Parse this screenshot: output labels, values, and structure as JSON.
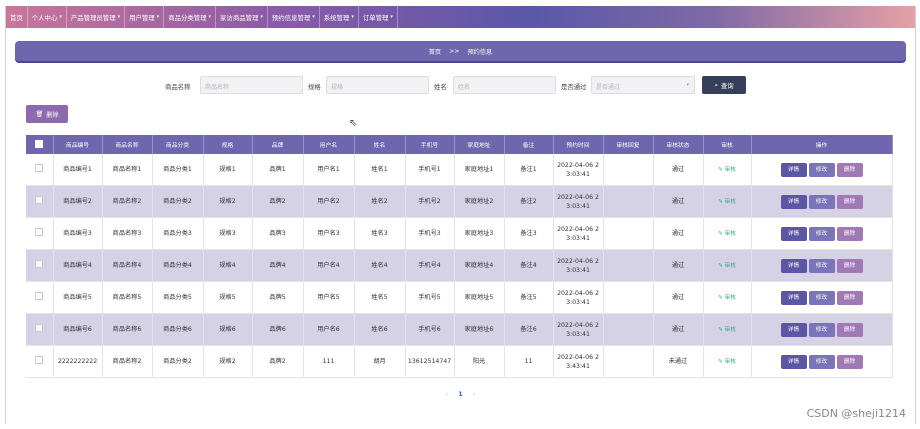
{
  "nav": [
    {
      "label": "首页",
      "arrow": ""
    },
    {
      "label": "个人中心",
      "arrow": "▾"
    },
    {
      "label": "产品管理员管理",
      "arrow": "▾"
    },
    {
      "label": "用户管理",
      "arrow": "▾"
    },
    {
      "label": "商品分类管理",
      "arrow": "▾"
    },
    {
      "label": "家访商品管理",
      "arrow": "▾"
    },
    {
      "label": "预约信息管理",
      "arrow": "▾"
    },
    {
      "label": "系统管理",
      "arrow": "▾"
    },
    {
      "label": "订单管理",
      "arrow": "▾"
    }
  ],
  "breadcrumb": {
    "home": "首页",
    "sep": ">>",
    "current": "预约信息"
  },
  "search": {
    "name_label": "商品名称",
    "name_placeholder": "商品名称",
    "spec_label": "规格",
    "spec_placeholder": "规格",
    "person_label": "姓名",
    "person_placeholder": "姓名",
    "pass_label": "是否通过",
    "pass_placeholder": "是否通过",
    "button_label": "查询"
  },
  "delete_button": "删除",
  "columns": [
    "商品编号",
    "商品名称",
    "商品分类",
    "规格",
    "品牌",
    "用户名",
    "姓名",
    "手机号",
    "家庭地址",
    "备注",
    "预约时间",
    "审核回复",
    "审核状态",
    "审核",
    "操作"
  ],
  "rows": [
    {
      "code": "商品编号1",
      "name": "商品名称1",
      "category": "商品分类1",
      "spec": "规格1",
      "brand": "品牌1",
      "user": "用户名1",
      "person": "姓名1",
      "phone": "手机号1",
      "address": "家庭地址1",
      "note": "备注1",
      "time": "2022-04-06 23:03:41",
      "reply": "",
      "status": "通过"
    },
    {
      "code": "商品编号2",
      "name": "商品名称2",
      "category": "商品分类2",
      "spec": "规格2",
      "brand": "品牌2",
      "user": "用户名2",
      "person": "姓名2",
      "phone": "手机号2",
      "address": "家庭地址2",
      "note": "备注2",
      "time": "2022-04-06 23:03:41",
      "reply": "",
      "status": "通过"
    },
    {
      "code": "商品编号3",
      "name": "商品名称3",
      "category": "商品分类3",
      "spec": "规格3",
      "brand": "品牌3",
      "user": "用户名3",
      "person": "姓名3",
      "phone": "手机号3",
      "address": "家庭地址3",
      "note": "备注3",
      "time": "2022-04-06 23:03:41",
      "reply": "",
      "status": "通过"
    },
    {
      "code": "商品编号4",
      "name": "商品名称4",
      "category": "商品分类4",
      "spec": "规格4",
      "brand": "品牌4",
      "user": "用户名4",
      "person": "姓名4",
      "phone": "手机号4",
      "address": "家庭地址4",
      "note": "备注4",
      "time": "2022-04-06 23:03:41",
      "reply": "",
      "status": "通过"
    },
    {
      "code": "商品编号5",
      "name": "商品名称5",
      "category": "商品分类5",
      "spec": "规格5",
      "brand": "品牌5",
      "user": "用户名5",
      "person": "姓名5",
      "phone": "手机号5",
      "address": "家庭地址5",
      "note": "备注5",
      "time": "2022-04-06 23:03:41",
      "reply": "",
      "status": "通过"
    },
    {
      "code": "商品编号6",
      "name": "商品名称6",
      "category": "商品分类6",
      "spec": "规格6",
      "brand": "品牌6",
      "user": "用户名6",
      "person": "姓名6",
      "phone": "手机号6",
      "address": "家庭地址6",
      "note": "备注6",
      "time": "2022-04-06 23:03:41",
      "reply": "",
      "status": "通过"
    },
    {
      "code": "2222222222",
      "name": "商品名称2",
      "category": "商品分类2",
      "spec": "规格2",
      "brand": "品牌2",
      "user": "111",
      "person": "胡月",
      "phone": "13612514747",
      "address": "阳光",
      "note": "11",
      "time": "2022-04-06 23:43:41",
      "reply": "",
      "status": "未通过"
    }
  ],
  "audit_label": "审核",
  "actions": {
    "detail": "详情",
    "edit": "修改",
    "remove": "删除"
  },
  "pager": {
    "prev": "‹",
    "page": "1",
    "next": "›"
  },
  "watermark": "CSDN @sheji1214"
}
